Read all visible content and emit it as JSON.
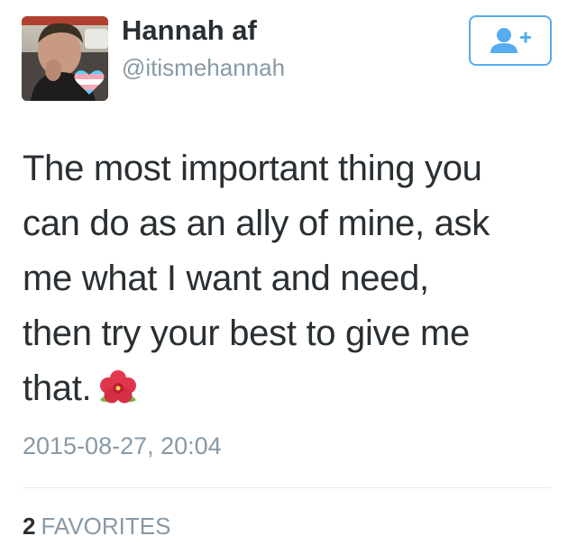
{
  "user": {
    "display_name": "Hannah af",
    "handle": "@itismehannah",
    "avatar_icon": "profile-photo-with-trans-heart",
    "follow_icon": "add-user-icon"
  },
  "tweet": {
    "lines": [
      "The most important thing you",
      "can do as an ally of mine, ask",
      "me what I want and need,",
      "then try your best to give me",
      "that."
    ],
    "emoji": "hibiscus-emoji",
    "timestamp": "2015-08-27, 20:04"
  },
  "stats": {
    "favorites_count": "2",
    "favorites_label": "FAVORITES"
  },
  "colors": {
    "accent": "#55acee",
    "text": "#292f33",
    "muted": "#8899a6",
    "divider": "#e1e8ed"
  }
}
